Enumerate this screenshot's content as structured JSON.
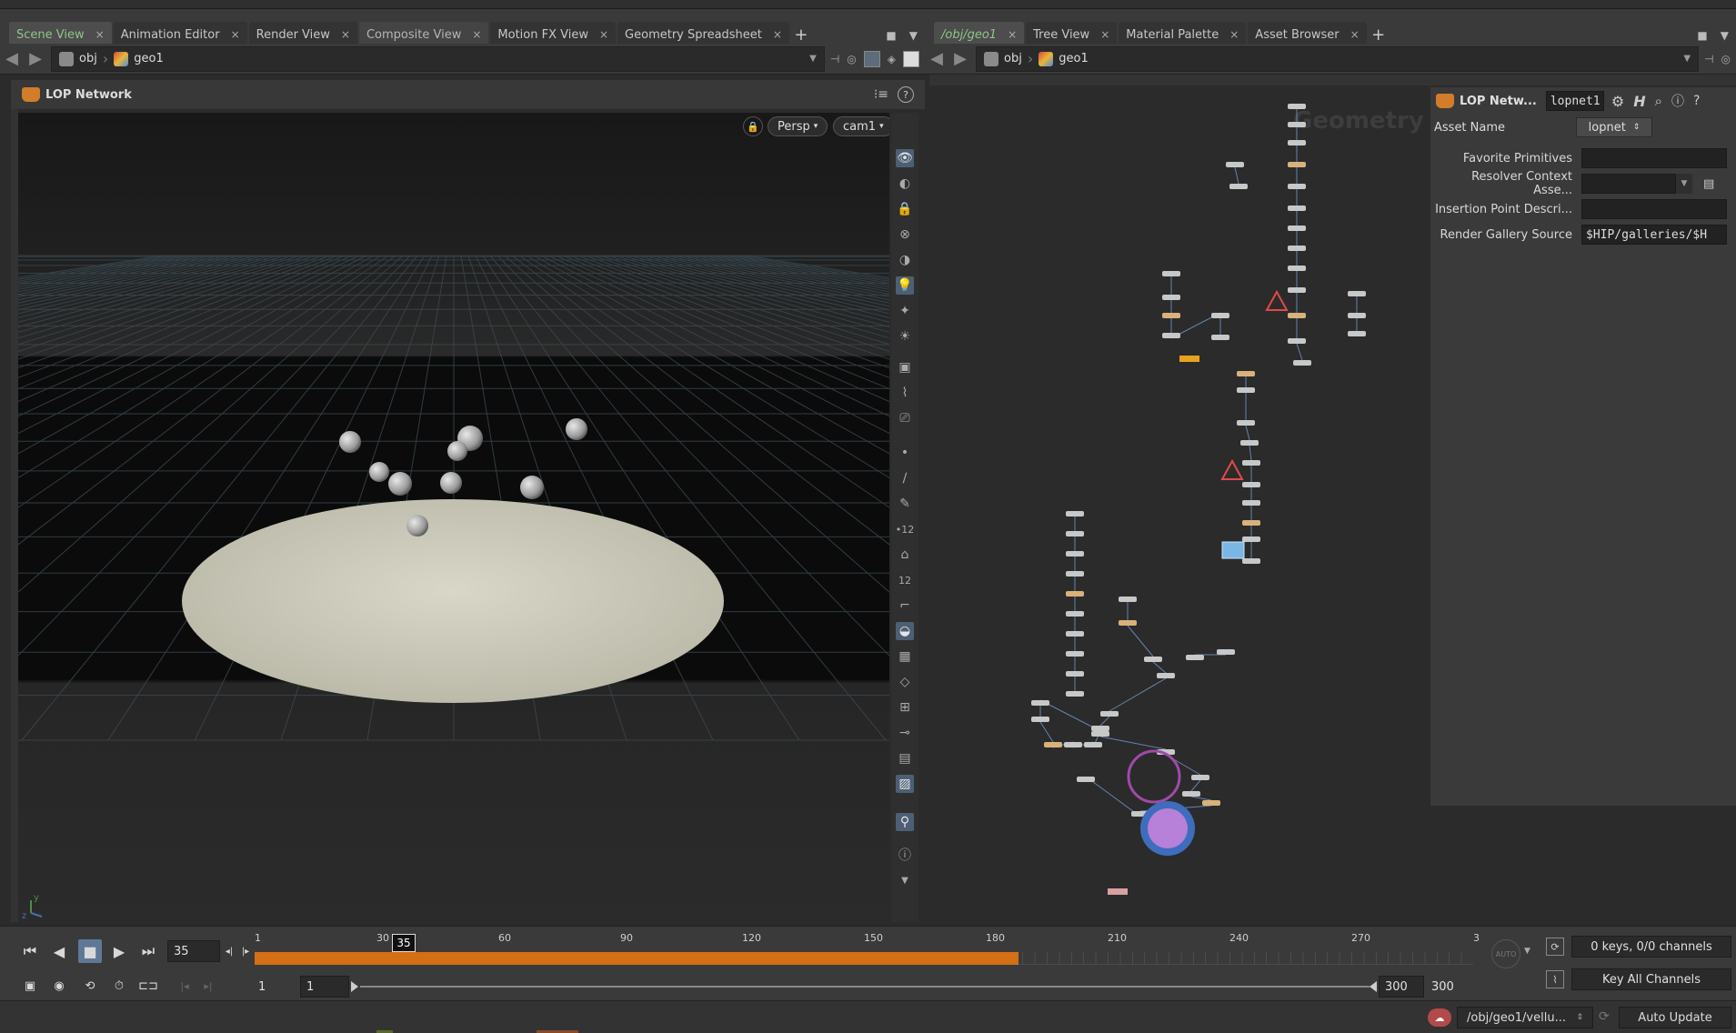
{
  "left_tabs": [
    {
      "label": "Scene View",
      "active": true
    },
    {
      "label": "Animation Editor"
    },
    {
      "label": "Render View"
    },
    {
      "label": "Composite View"
    },
    {
      "label": "Motion FX View"
    },
    {
      "label": "Geometry Spreadsheet"
    }
  ],
  "right_tabs": [
    {
      "label": "/obj/geo1",
      "active": true
    },
    {
      "label": "Tree View"
    },
    {
      "label": "Material Palette"
    },
    {
      "label": "Asset Browser"
    }
  ],
  "left_path": {
    "crumb1": "obj",
    "crumb2": "geo1"
  },
  "right_path": {
    "crumb1": "obj",
    "crumb2": "geo1"
  },
  "viewer": {
    "title": "LOP Network",
    "persp_label": "Persp",
    "camera_label": "cam1",
    "axis_y": "y",
    "axis_z": "z"
  },
  "network": {
    "watermark": "Geometry",
    "param_header": {
      "title": "LOP Netw...",
      "node_name": "lopnet1"
    },
    "asset_name_label": "Asset Name",
    "asset_name_value": "lopnet",
    "params": [
      {
        "label": "Favorite Primitives",
        "value": ""
      },
      {
        "label": "Resolver Context Asse...",
        "value": ""
      },
      {
        "label": "Insertion Point Descri...",
        "value": ""
      },
      {
        "label": "Render Gallery Source",
        "value": "$HIP/galleries/$H"
      }
    ]
  },
  "timeline": {
    "current_frame": "35",
    "marker_frame": "35",
    "frame_marker_fraction": 0.113,
    "cache_fraction": 0.627,
    "ticks": [
      "1",
      "30",
      "60",
      "90",
      "120",
      "150",
      "180",
      "210",
      "240",
      "270",
      "3"
    ],
    "range_start": "1",
    "range_start2": "1",
    "range_end": "300",
    "range_end2": "300",
    "keys_label": "0 keys, 0/0 channels",
    "key_all_label": "Key All Channels",
    "auto_label": "AUTO"
  },
  "status": {
    "path": "/obj/geo1/vellu...",
    "update_mode": "Auto Update"
  },
  "colors": {
    "active_tab_text": "#8fc48a",
    "timeline_orange": "#d46f16",
    "selection_blue": "#4d5f74"
  }
}
